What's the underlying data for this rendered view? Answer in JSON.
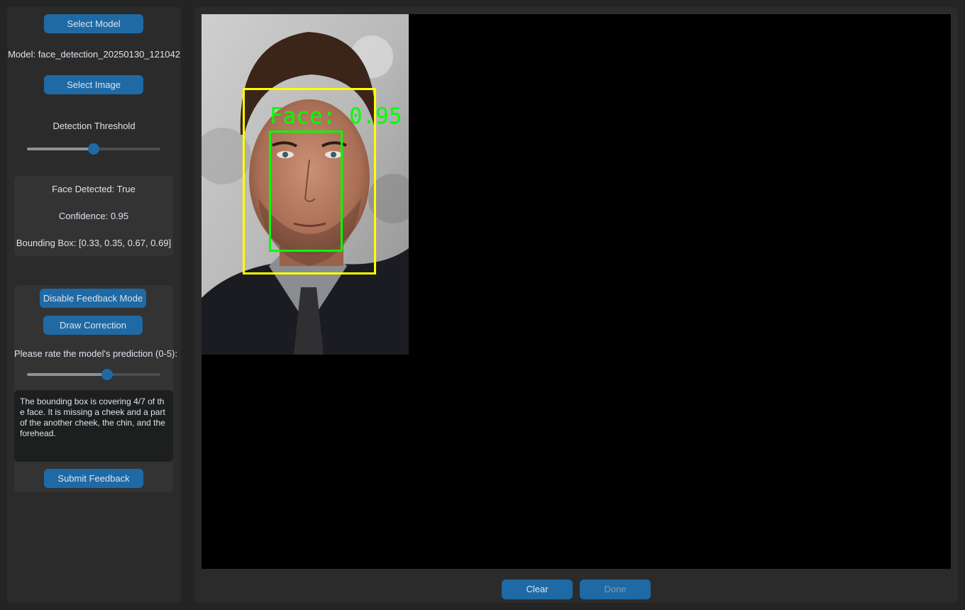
{
  "sidebar": {
    "select_model_label": "Select Model",
    "model_text": "Model: face_detection_20250130_121042",
    "select_image_label": "Select Image",
    "threshold_label": "Detection Threshold",
    "threshold_value": 0.5,
    "results": {
      "face_detected": "Face Detected: True",
      "confidence": "Confidence: 0.95",
      "bounding_box": "Bounding Box: [0.33, 0.35, 0.67, 0.69]"
    },
    "feedback": {
      "disable_feedback_label": "Disable Feedback Mode",
      "draw_correction_label": "Draw Correction",
      "rating_prompt": "Please rate the model's prediction (0-5):",
      "rating_value": 3,
      "rating_max": 5,
      "feedback_text": "The bounding box is covering 4/7 of the face. It is missing a cheek and a part of the another cheek, the chin, and the forehead.",
      "submit_label": "Submit Feedback"
    }
  },
  "canvas": {
    "face_label": "Face: 0.95",
    "prediction_box_color": "#00ff00",
    "correction_box_color": "#ffff00"
  },
  "footer": {
    "clear_label": "Clear",
    "done_label": "Done"
  },
  "colors": {
    "accent": "#1f6aa5",
    "panel": "#2b2b2b",
    "background": "#242424"
  }
}
